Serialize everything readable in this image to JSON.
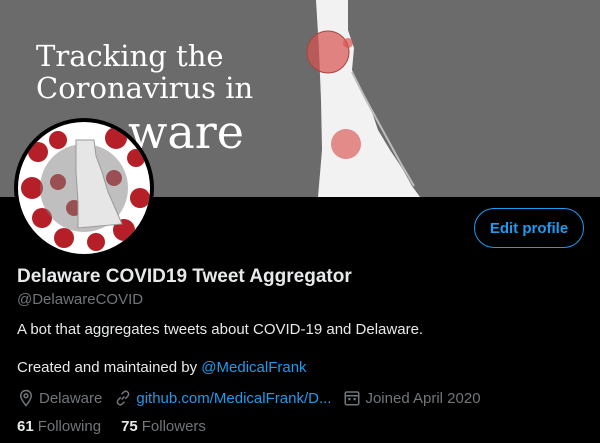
{
  "banner": {
    "line1": "Tracking the",
    "line2": "Coronavirus in",
    "line3": "ware"
  },
  "profile": {
    "name": "Delaware COVID19 Tweet Aggregator",
    "handle": "@DelawareCOVID",
    "bio": "A bot that aggregates tweets about COVID-19 and Delaware.",
    "created_prefix": "Created and maintained by ",
    "created_link": "@MedicalFrank",
    "location": "Delaware",
    "website": "github.com/MedicalFrank/D...",
    "joined": "Joined April 2020"
  },
  "stats": {
    "following_count": "61",
    "following_label": "Following",
    "followers_count": "75",
    "followers_label": "Followers"
  },
  "buttons": {
    "edit_profile": "Edit profile"
  },
  "icons": {
    "location": "map-pin-icon",
    "website": "link-icon",
    "joined": "calendar-icon"
  },
  "colors": {
    "accent": "#1d9bf0",
    "background": "#000000",
    "banner": "#6b6b6b",
    "text_primary": "#e7e9ea",
    "text_secondary": "#71767b",
    "virus_red": "#c0202a"
  }
}
